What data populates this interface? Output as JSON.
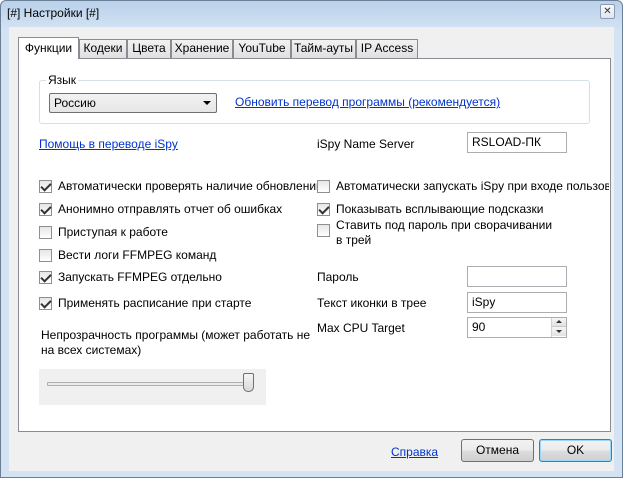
{
  "window": {
    "title": "[#] Настройки [#]",
    "close_glyph": "✕"
  },
  "tabs": [
    {
      "label": "Функции"
    },
    {
      "label": "Кодеки"
    },
    {
      "label": "Цвета"
    },
    {
      "label": "Хранение"
    },
    {
      "label": "YouTube"
    },
    {
      "label": "Тайм-ауты"
    },
    {
      "label": "IP Access"
    }
  ],
  "language": {
    "group_label": "Язык",
    "selected": "Россию",
    "update_link": "Обновить перевод программы (рекомендуется)"
  },
  "help_translate_link": "Помощь в переводе iSpy",
  "name_server": {
    "label": "iSpy Name Server",
    "value": "RSLOAD-ПК"
  },
  "left_checks": [
    {
      "label": "Автоматически проверять наличие обновлений",
      "checked": true
    },
    {
      "label": "Анонимно отправлять отчет об ошибках",
      "checked": true
    },
    {
      "label": "Приступая к работе",
      "checked": false
    },
    {
      "label": "Вести логи FFMPEG команд",
      "checked": false
    },
    {
      "label": "Запускать FFMPEG отдельно",
      "checked": true
    },
    {
      "label": "Применять расписание при старте",
      "checked": true
    }
  ],
  "right_checks": [
    {
      "label": "Автоматически запускать iSpy при входе пользовате",
      "checked": false
    },
    {
      "label": "Показывать всплывающие подсказки",
      "checked": true
    },
    {
      "label": "Ставить под пароль при сворачивании в трей",
      "checked": false
    }
  ],
  "password": {
    "label": "Пароль",
    "value": ""
  },
  "tray_icon_text": {
    "label": "Текст иконки в трее",
    "value": "iSpy"
  },
  "max_cpu": {
    "label": "Max CPU Target",
    "value": "90"
  },
  "opacity": {
    "label": "Непрозрачность программы (может работать не на всех системах)",
    "level": 1.0
  },
  "footer": {
    "help_link": "Справка",
    "cancel_label": "Отмена",
    "ok_label": "OK"
  },
  "colors": {
    "link": "#0033cc",
    "titlebar": "#b9d1ea"
  }
}
